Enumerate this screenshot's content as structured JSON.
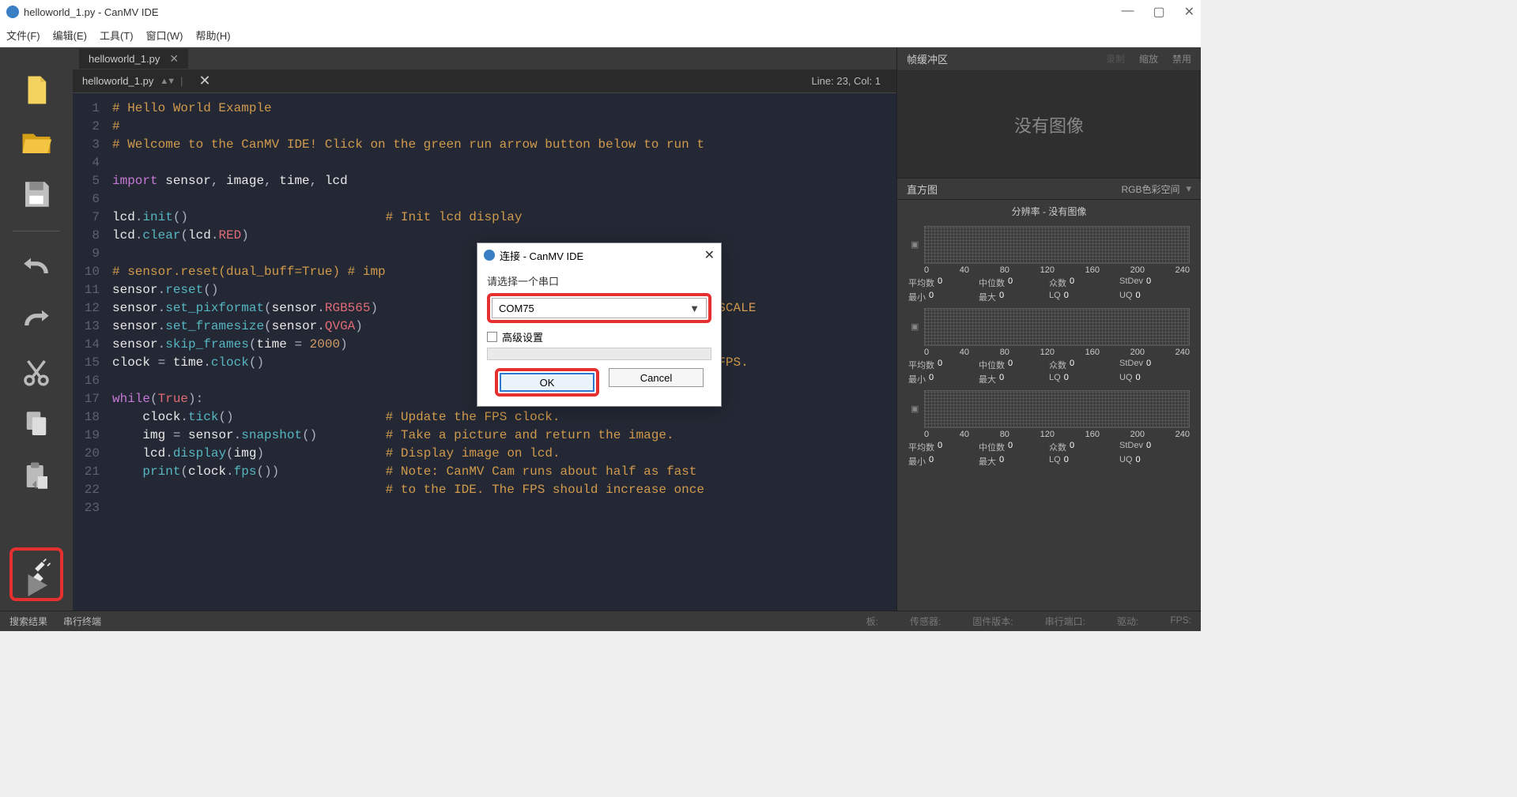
{
  "window": {
    "title": "helloworld_1.py - CanMV IDE"
  },
  "menu": {
    "file": "文件(F)",
    "edit": "编辑(E)",
    "tools": "工具(T)",
    "window": "窗口(W)",
    "help": "帮助(H)"
  },
  "tab": {
    "name": "helloworld_1.py"
  },
  "file_selector": {
    "name": "helloworld_1.py",
    "linecol": "Line: 23, Col: 1"
  },
  "code": {
    "lines": [
      {
        "n": "1",
        "html": "<span class='c-comment'># Hello World Example</span>"
      },
      {
        "n": "2",
        "html": "<span class='c-comment'>#</span>"
      },
      {
        "n": "3",
        "html": "<span class='c-comment'># Welcome to the CanMV IDE! Click on the green run arrow button below to run t</span>"
      },
      {
        "n": "4",
        "html": ""
      },
      {
        "n": "5",
        "html": "<span class='c-keyword'>import</span> <span class='c-ident'>sensor</span>, <span class='c-ident'>image</span>, <span class='c-ident'>time</span>, <span class='c-ident'>lcd</span>"
      },
      {
        "n": "6",
        "html": ""
      },
      {
        "n": "7",
        "html": "<span class='c-ident'>lcd</span>.<span class='c-func'>init</span>()                          <span class='c-comment'># Init lcd display</span>"
      },
      {
        "n": "8",
        "html": "<span class='c-ident'>lcd</span>.<span class='c-func'>clear</span>(<span class='c-ident'>lcd</span>.<span class='c-const'>RED</span>)"
      },
      {
        "n": "9",
        "html": ""
      },
      {
        "n": "10",
        "html": "<span class='c-comment'># sensor.reset(dual_buff=True) # imp</span>"
      },
      {
        "n": "11",
        "html": "<span class='c-ident'>sensor</span>.<span class='c-func'>reset</span>()                      <span style='margin-left:315px'></span><span class='c-comment'> sensor.</span>"
      },
      {
        "n": "12",
        "html": "<span class='c-ident'>sensor</span>.<span class='c-func'>set_pixformat</span>(<span class='c-ident'>sensor</span>.<span class='c-const'>RGB565</span>) <span style='margin-left:315px'></span><span class='c-comment'>65 (or GRAYSCALE</span>"
      },
      {
        "n": "13",
        "html": "<span class='c-ident'>sensor</span>.<span class='c-func'>set_framesize</span>(<span class='c-ident'>sensor</span>.<span class='c-const'>QVGA</span>)   <span style='margin-left:315px'></span><span class='c-comment'>320x240)</span>"
      },
      {
        "n": "14",
        "html": "<span class='c-ident'>sensor</span>.<span class='c-func'>skip_frames</span>(<span class='c-ident'>time</span> = <span class='c-num'>2000</span>)     <span style='margin-left:315px'></span><span class='c-comment'>ffect.</span>"
      },
      {
        "n": "15",
        "html": "<span class='c-ident'>clock</span> = <span class='c-ident'>time</span>.<span class='c-func'>clock</span>()                <span style='margin-left:315px'></span><span class='c-comment'> track the FPS.</span>"
      },
      {
        "n": "16",
        "html": ""
      },
      {
        "n": "17",
        "html": "<span class='c-keyword'>while</span>(<span class='c-const'>True</span>):"
      },
      {
        "n": "18",
        "html": "    <span class='c-ident'>clock</span>.<span class='c-func'>tick</span>()                    <span class='c-comment'># Update the FPS clock.</span>"
      },
      {
        "n": "19",
        "html": "    <span class='c-ident'>img</span> = <span class='c-ident'>sensor</span>.<span class='c-func'>snapshot</span>()         <span class='c-comment'># Take a picture and return the image.</span>"
      },
      {
        "n": "20",
        "html": "    <span class='c-ident'>lcd</span>.<span class='c-func'>display</span>(<span class='c-ident'>img</span>)                <span class='c-comment'># Display image on lcd.</span>"
      },
      {
        "n": "21",
        "html": "    <span class='c-func'>print</span>(<span class='c-ident'>clock</span>.<span class='c-func'>fps</span>())              <span class='c-comment'># Note: CanMV Cam runs about half as fast</span>"
      },
      {
        "n": "22",
        "html": "                                    <span class='c-comment'># to the IDE. The FPS should increase once</span>"
      },
      {
        "n": "23",
        "html": ""
      }
    ]
  },
  "right": {
    "framebuf_title": "帧缓冲区",
    "record": "录制",
    "zoom": "缩放",
    "disable": "禁用",
    "noimage": "没有图像",
    "hist_title": "直方图",
    "hist_mode": "RGB色彩空间",
    "resolution": "分辨率 - 没有图像",
    "axis": [
      "0",
      "40",
      "80",
      "120",
      "160",
      "200",
      "240"
    ],
    "stats": {
      "mean_l": "平均数",
      "mean_v": "0",
      "median_l": "中位数",
      "median_v": "0",
      "mode_l": "众数",
      "mode_v": "0",
      "stdev_l": "StDev",
      "stdev_v": "0",
      "min_l": "最小",
      "min_v": "0",
      "max_l": "最大",
      "max_v": "0",
      "lq_l": "LQ",
      "lq_v": "0",
      "uq_l": "UQ",
      "uq_v": "0"
    }
  },
  "status": {
    "search_results": "搜索结果",
    "serial_terminal": "串行终端",
    "board": "板:",
    "sensor": "传感器:",
    "firmware": "固件版本:",
    "serial_port": "串行端口:",
    "drive": "驱动:",
    "fps": "FPS:"
  },
  "dialog": {
    "title": "连接 - CanMV IDE",
    "prompt": "请选择一个串口",
    "selected": "COM75",
    "advanced": "高级设置",
    "ok": "OK",
    "cancel": "Cancel"
  }
}
